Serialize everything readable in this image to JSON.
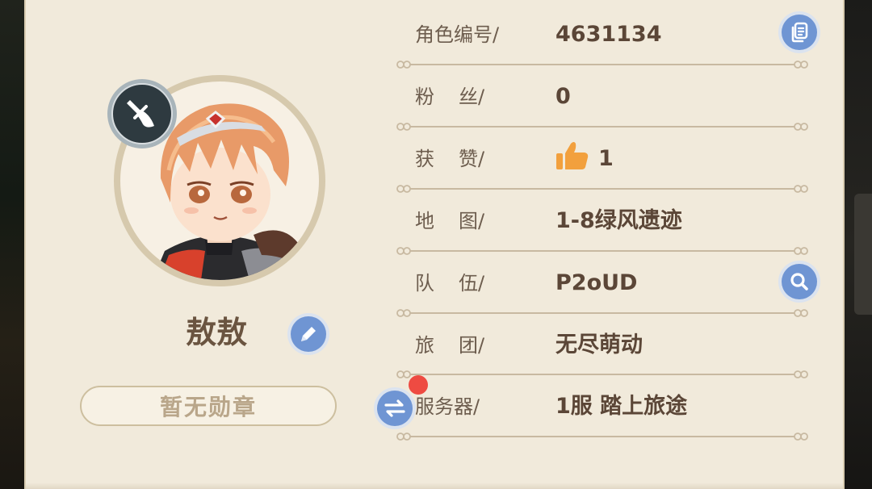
{
  "profile": {
    "name": "敖敖",
    "medal": "暂无勋章"
  },
  "info": {
    "id_label": "角色编号/",
    "id_value": "4631134",
    "fans_label_a": "粉",
    "fans_label_b": "丝/",
    "fans_value": "0",
    "likes_label_a": "获",
    "likes_label_b": "赞/",
    "likes_value": "1",
    "map_label_a": "地",
    "map_label_b": "图/",
    "map_value": "1-8绿风遗迹",
    "team_label_a": "队",
    "team_label_b": "伍/",
    "team_value": "P2oUD",
    "guild_label_a": "旅",
    "guild_label_b": "团/",
    "guild_value": "无尽萌动",
    "server_label": "服务器/",
    "server_value": "1服  踏上旅途"
  },
  "icons": {
    "class": "sword-class-icon",
    "edit": "pencil-icon",
    "switch": "swap-arrows-icon",
    "search": "search-icon",
    "copy": "copy-document-icon",
    "thumb": "thumbs-up-icon"
  },
  "colors": {
    "panel": "#f1eadb",
    "button_blue": "#6f95d3",
    "notification_red": "#ee4b42",
    "thumb_orange": "#f2a03d",
    "text_dark": "#5b4637"
  }
}
